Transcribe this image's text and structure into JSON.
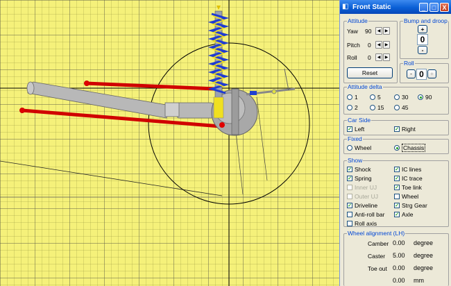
{
  "window": {
    "title": "Front Static",
    "minimize_label": "_",
    "maximize_label": "□",
    "close_label": "X"
  },
  "attitude": {
    "label": "Attitude",
    "rows": [
      {
        "label": "Yaw",
        "value": "90"
      },
      {
        "label": "Pitch",
        "value": "0"
      },
      {
        "label": "Roll",
        "value": "0"
      }
    ],
    "reset_label": "Reset"
  },
  "bump": {
    "label": "Bump and droop",
    "plus": "+",
    "value": "0",
    "minus": "-"
  },
  "roll": {
    "label": "Roll",
    "minus": "-",
    "value": "0",
    "plus": "+"
  },
  "attitude_delta": {
    "label": "Attitude delta",
    "options": [
      "1",
      "5",
      "30",
      "90",
      "2",
      "15",
      "45"
    ],
    "selected": "90"
  },
  "car_side": {
    "label": "Car Side",
    "left": "Left",
    "right": "Right"
  },
  "fixed": {
    "label": "Fixed",
    "wheel": "Wheel",
    "chassis": "Chassis",
    "selected": "Chassis"
  },
  "show": {
    "label": "Show",
    "left_items": [
      {
        "label": "Shock",
        "checked": true,
        "enabled": true
      },
      {
        "label": "Spring",
        "checked": true,
        "enabled": true
      },
      {
        "label": "Inner UJ",
        "checked": false,
        "enabled": false
      },
      {
        "label": "Outer UJ",
        "checked": false,
        "enabled": false
      },
      {
        "label": "Driveline",
        "checked": true,
        "enabled": true
      },
      {
        "label": "Anti-roll bar",
        "checked": false,
        "enabled": true
      },
      {
        "label": "Roll axis",
        "checked": false,
        "enabled": true
      }
    ],
    "right_items": [
      {
        "label": "IC lines",
        "checked": true,
        "enabled": true
      },
      {
        "label": "IC trace",
        "checked": true,
        "enabled": true
      },
      {
        "label": "Toe link",
        "checked": true,
        "enabled": true
      },
      {
        "label": "Wheel",
        "checked": false,
        "enabled": true
      },
      {
        "label": "Strg Gear",
        "checked": true,
        "enabled": true
      },
      {
        "label": "Axle",
        "checked": true,
        "enabled": true
      }
    ]
  },
  "wheel_alignment": {
    "label": "Wheel alignment (LH)",
    "rows": [
      {
        "label": "Camber",
        "value": "0.00",
        "unit": "degree"
      },
      {
        "label": "Caster",
        "value": "5.00",
        "unit": "degree"
      },
      {
        "label": "Toe out",
        "value": "0.00",
        "unit": "degree"
      },
      {
        "label": "",
        "value": "0.00",
        "unit": "mm"
      }
    ]
  },
  "colors": {
    "viewport_bg": "#f5f17a",
    "arm": "#e00000",
    "shaft": "#b8b8b8",
    "spring_blue": "#1f3bd1",
    "spring_yellow": "#f0e020",
    "group_label": "#0046d5",
    "title_bar": "#0a5fd6"
  }
}
